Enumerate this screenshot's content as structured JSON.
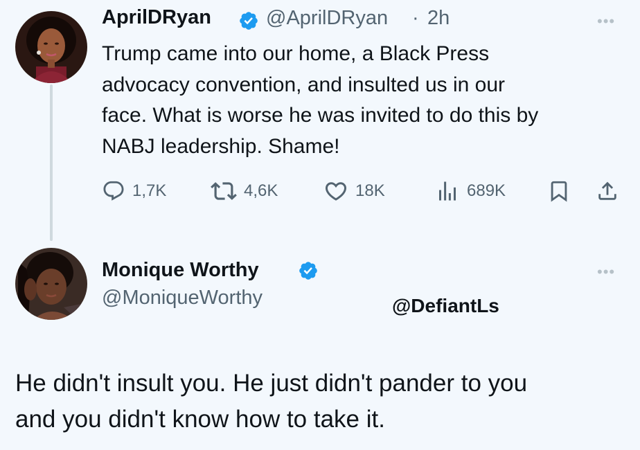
{
  "tweet": {
    "author_name": "AprilDRyan",
    "handle": "@AprilDRyan",
    "separator": "·",
    "time": "2h",
    "text": "Trump came into our home, a Black Press\nadvocacy convention, and insulted us in our\nface. What is worse he was invited to do this by\nNABJ leadership. Shame!",
    "actions": {
      "replies": "1,7K",
      "reposts": "4,6K",
      "likes": "18K",
      "views": "689K"
    },
    "more_icon": "ellipsis-icon",
    "verified_icon": "verified-badge-icon"
  },
  "reply": {
    "author_name": "Monique Worthy",
    "handle": "@MoniqueWorthy",
    "text": "He didn't insult you. He just didn't pander to you\nand you didn't know how to take it.",
    "more_icon": "ellipsis-icon",
    "verified_icon": "verified-badge-icon"
  },
  "watermark": "@DefiantLs",
  "colors": {
    "background": "#f3f8fd",
    "text": "#0f1419",
    "secondary": "#536471",
    "verified": "#1d9bf0",
    "thread_line": "#cfd9de"
  }
}
